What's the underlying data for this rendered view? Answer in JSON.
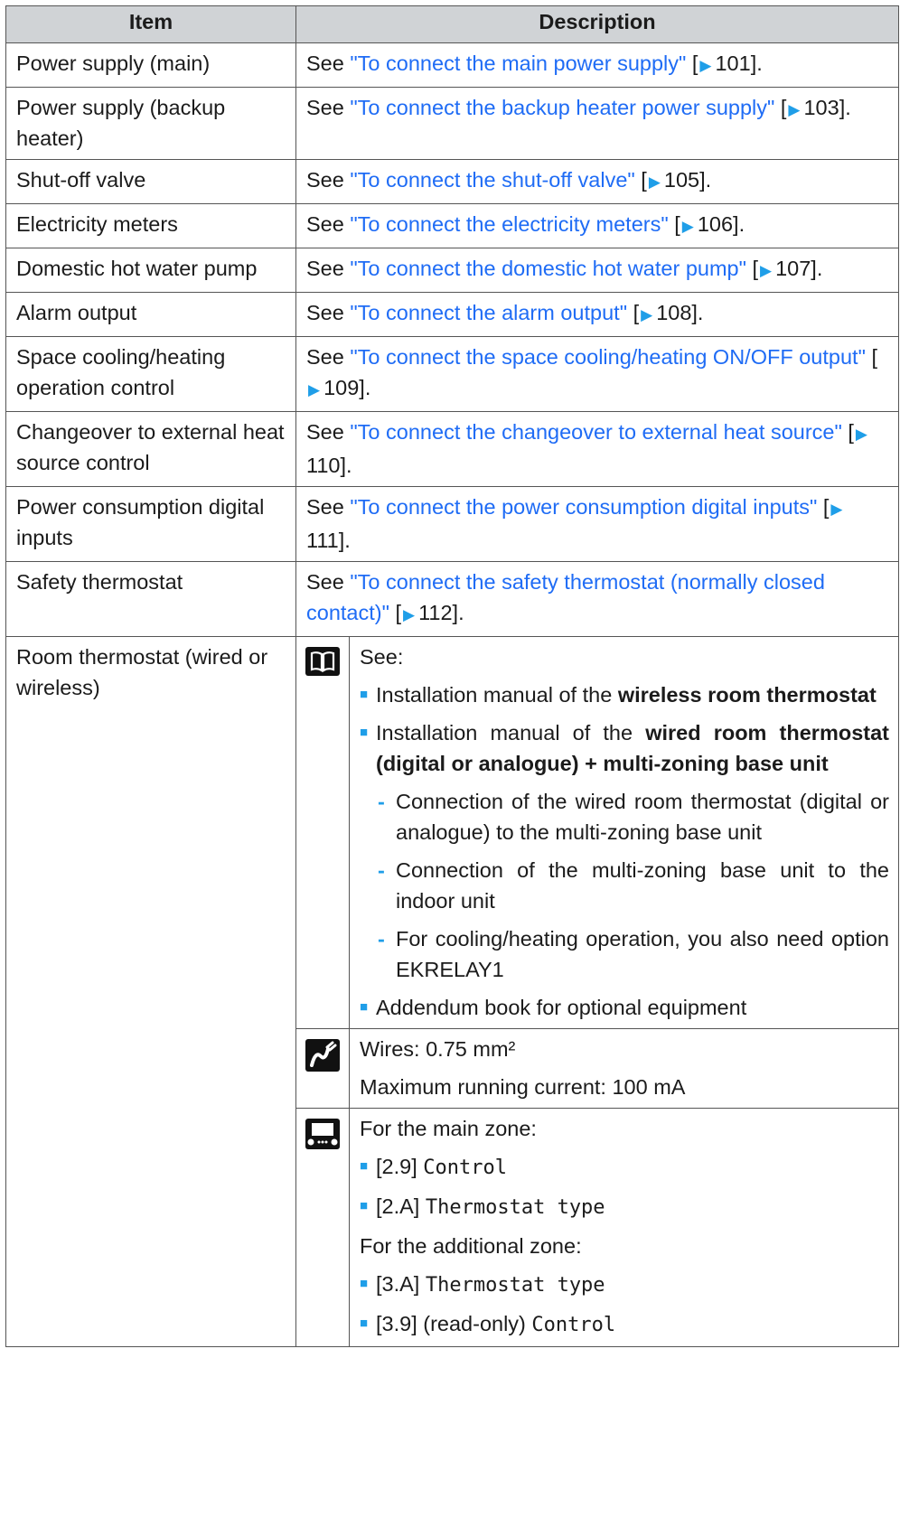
{
  "header": {
    "item": "Item",
    "description": "Description"
  },
  "rows": [
    {
      "item": "Power supply (main)",
      "see": "See ",
      "link": "\"To connect the main power supply\"",
      "page": "101]."
    },
    {
      "item": "Power supply (backup heater)",
      "see": "See ",
      "link": "\"To connect the backup heater power supply\"",
      "page": "103]."
    },
    {
      "item": "Shut-off valve",
      "see": "See ",
      "link": "\"To connect the shut-off valve\"",
      "page": "105]."
    },
    {
      "item": "Electricity meters",
      "see": "See ",
      "link": "\"To connect the electricity meters\"",
      "page": "106]."
    },
    {
      "item": "Domestic hot water pump",
      "see": "See ",
      "link": "\"To connect the domestic hot water pump\"",
      "page": "107]."
    },
    {
      "item": "Alarm output",
      "see": "See ",
      "link": "\"To connect the alarm output\"",
      "page": "108]."
    },
    {
      "item": "Space cooling/heating operation control",
      "see": "See ",
      "link": "\"To connect the space cooling/heating ON/OFF output\"",
      "page": "109]."
    },
    {
      "item": "Changeover to external heat source control",
      "see": "See ",
      "link": "\"To connect the changeover to external heat source\"",
      "page": "110]."
    },
    {
      "item": "Power consumption digital inputs",
      "see": "See ",
      "link": "\"To connect the power consumption digital inputs\"",
      "page": "111]."
    },
    {
      "item": "Safety thermostat",
      "see": "See ",
      "link": "\"To connect the safety thermostat (normally closed contact)\"",
      "page": "112]."
    }
  ],
  "room": {
    "item": "Room thermostat (wired or wireless)",
    "manual": {
      "see": "See:",
      "b1_pre": "Installation manual of the ",
      "b1_bold": "wireless room thermostat",
      "b2_pre": "Installation manual of the ",
      "b2_bold": "wired room thermostat (digital or analogue) + multi-zoning base unit",
      "sub1": "Connection of the wired room thermostat (digital or analogue) to the multi-zoning base unit",
      "sub2": "Connection of the multi-zoning base unit to the indoor unit",
      "sub3": "For cooling/heating operation, you also need option EKRELAY1",
      "b3": "Addendum book for optional equipment",
      "dash": "-"
    },
    "wires": {
      "line1": "Wires: 0.75 mm²",
      "line2": "Maximum running current: 100 mA"
    },
    "settings": {
      "main_zone": "For the main zone:",
      "s1_code": "[2.9] ",
      "s1_name": "Control",
      "s2_code": "[2.A] ",
      "s2_name": "Thermostat type",
      "add_zone": "For the additional zone:",
      "s3_code": "[3.A] ",
      "s3_name": "Thermostat type",
      "s4_code": "[3.9] (read-only) ",
      "s4_name": "Control"
    }
  },
  "icons": {
    "arrow": "arrow-right-icon",
    "bullet": "square-bullet-icon",
    "book": "book-icon",
    "wire": "wire-icon",
    "ui": "user-interface-icon"
  },
  "colors": {
    "link": "#1f6cf5",
    "bullet": "#1f9ee8",
    "header_bg": "#d0d3d6"
  }
}
